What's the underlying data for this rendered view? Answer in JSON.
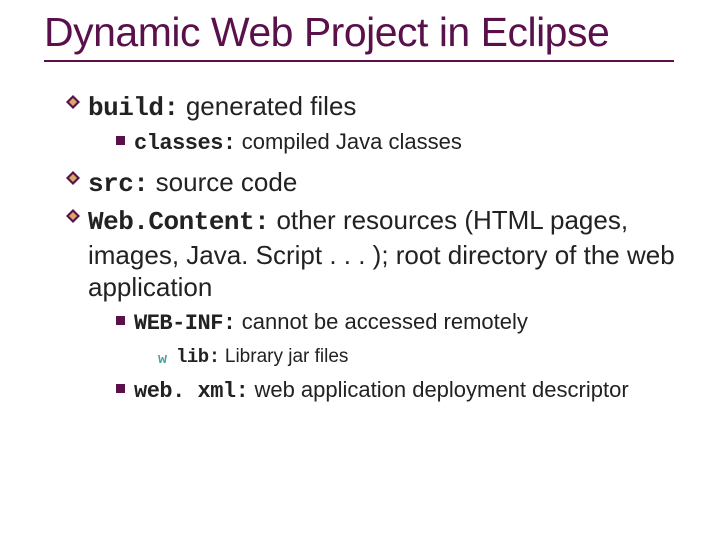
{
  "title": "Dynamic Web Project in Eclipse",
  "items": [
    {
      "code": "build:",
      "text": " generated files"
    },
    {
      "code": "classes:",
      "text": " compiled Java classes"
    },
    {
      "code": "src:",
      "text": " source code"
    },
    {
      "code": "Web.Content:",
      "text": " other resources (HTML pages, images, Java. Script . . . ); root directory of the web application"
    },
    {
      "code": "WEB-INF:",
      "text": " cannot be accessed remotely"
    },
    {
      "code": "lib:",
      "text": " Library jar files"
    },
    {
      "code": "web. xml:",
      "text": " web application deployment descriptor"
    }
  ]
}
